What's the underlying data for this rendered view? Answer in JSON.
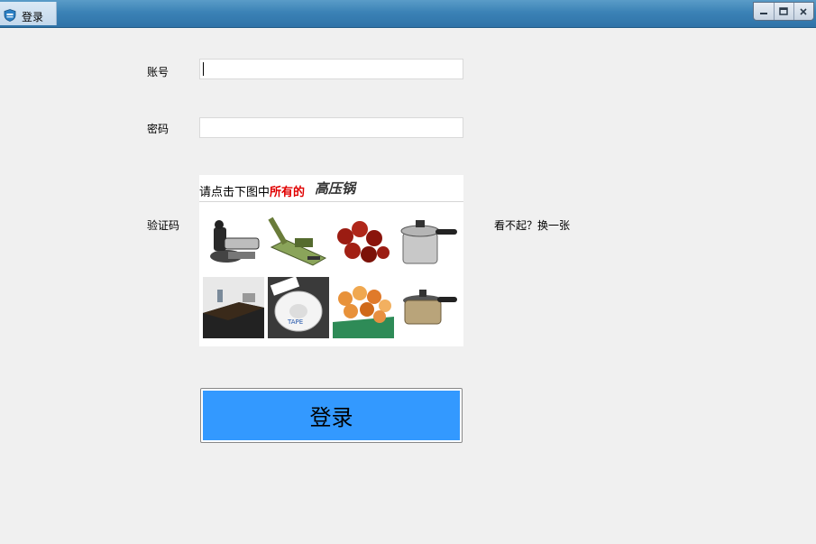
{
  "window": {
    "title": "登录"
  },
  "form": {
    "account_label": "账号",
    "account_value": "",
    "password_label": "密码",
    "password_value": "",
    "captcha_label": "验证码",
    "refresh_label": "看不起？换一张",
    "login_label": "登录"
  },
  "captcha": {
    "instruction": "请点击下图中",
    "instruction_highlight": "所有的",
    "target_word": "高压锅",
    "tiles": [
      "stapler",
      "paper-cutter",
      "red-dates",
      "pressure-cooker",
      "office-desks",
      "tape-roll",
      "candied-fruit",
      "pressure-cooker"
    ]
  },
  "colors": {
    "login_button": "#3399ff",
    "highlight": "#e00000",
    "titlebar": "#3b82b6"
  }
}
